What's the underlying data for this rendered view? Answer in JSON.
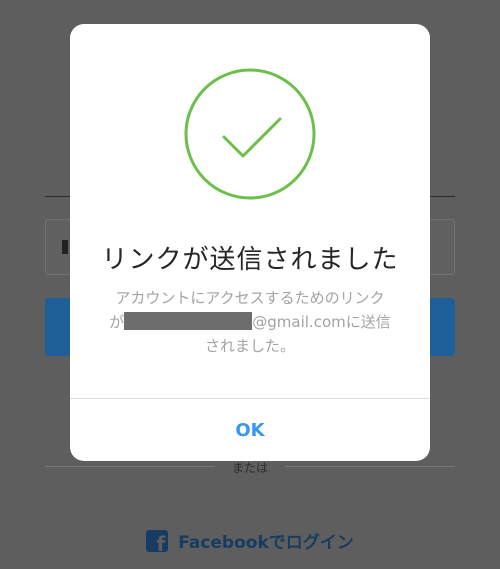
{
  "background": {
    "or_text": "または",
    "facebook_login_label": "Facebookでログイン"
  },
  "dialog": {
    "icon": "check-circle-icon",
    "accent_color": "#6cc04a",
    "title": "リンクが送信されました",
    "message_line1": "アカウントにアクセスするためのリンク",
    "message_prefix": "が",
    "email_suffix": "@gmail.comに送信",
    "message_end": "されました。",
    "ok_label": "OK",
    "ok_color": "#3797f0"
  }
}
